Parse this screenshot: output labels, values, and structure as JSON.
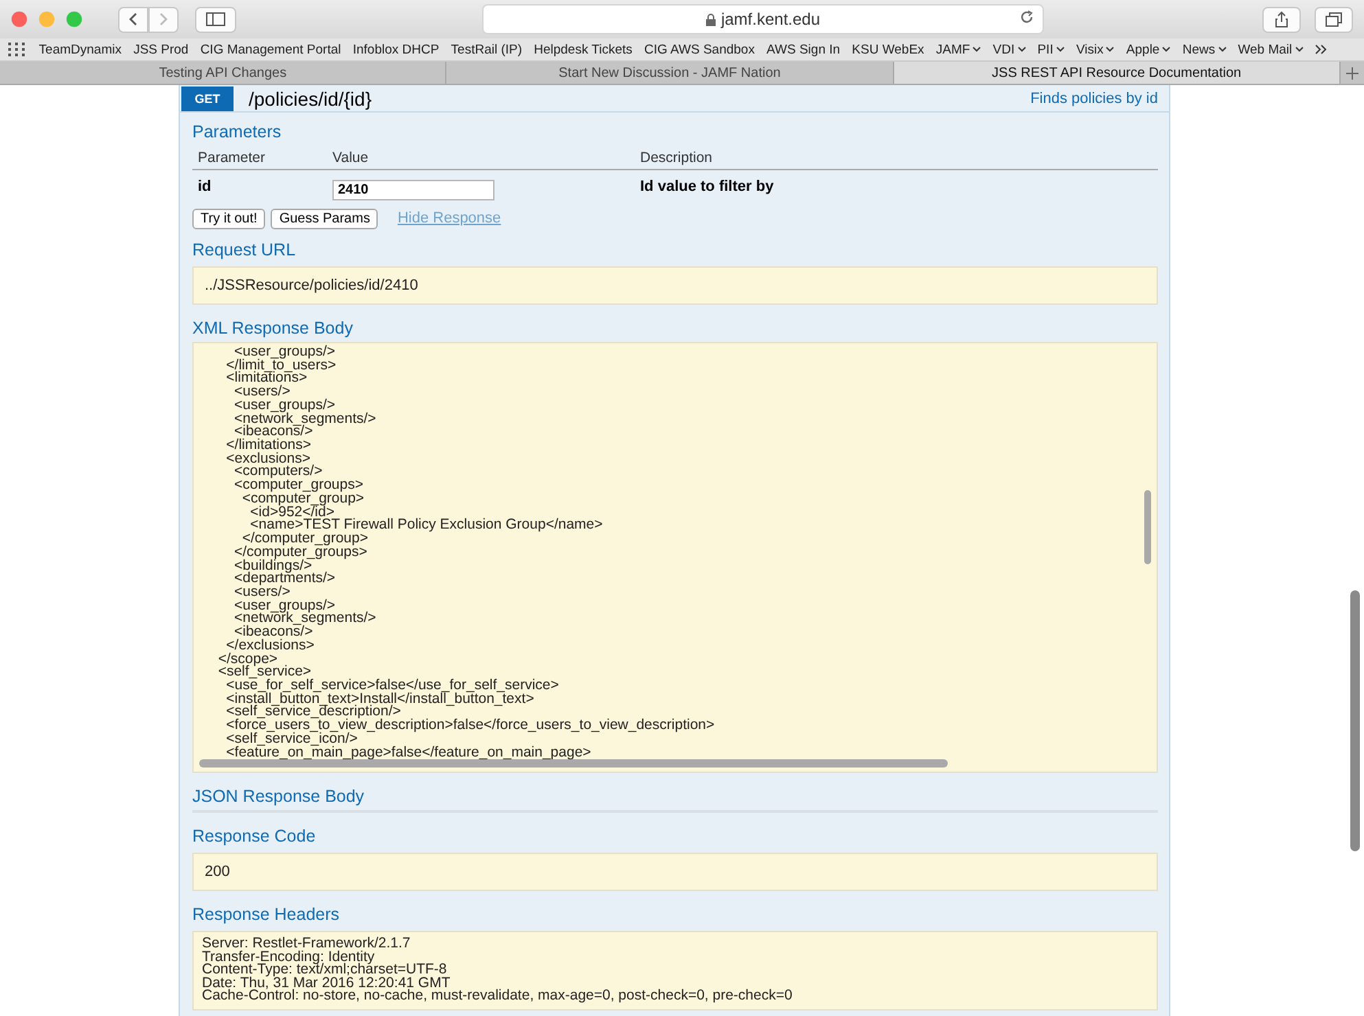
{
  "toolbar": {
    "url": "jamf.kent.edu"
  },
  "bookmarks": [
    {
      "label": "TeamDynamix",
      "kind": "link"
    },
    {
      "label": "JSS Prod",
      "kind": "link"
    },
    {
      "label": "CIG Management Portal",
      "kind": "link"
    },
    {
      "label": "Infoblox DHCP",
      "kind": "link"
    },
    {
      "label": "TestRail (IP)",
      "kind": "link"
    },
    {
      "label": "Helpdesk Tickets",
      "kind": "link"
    },
    {
      "label": "CIG AWS Sandbox",
      "kind": "link"
    },
    {
      "label": "AWS Sign In",
      "kind": "link"
    },
    {
      "label": "KSU WebEx",
      "kind": "link"
    },
    {
      "label": "JAMF",
      "kind": "folder"
    },
    {
      "label": "VDI",
      "kind": "folder"
    },
    {
      "label": "PII",
      "kind": "folder"
    },
    {
      "label": "Visix",
      "kind": "folder"
    },
    {
      "label": "Apple",
      "kind": "folder"
    },
    {
      "label": "News",
      "kind": "folder"
    },
    {
      "label": "Web Mail",
      "kind": "folder"
    }
  ],
  "tabs": [
    {
      "label": "Testing API Changes",
      "selected": false
    },
    {
      "label": "Start New Discussion - JAMF Nation",
      "selected": false
    },
    {
      "label": "JSS REST API Resource Documentation",
      "selected": true
    }
  ],
  "operation": {
    "method": "GET",
    "path": "/policies/id/{id}",
    "summary": "Finds policies by id",
    "parameters_title": "Parameters",
    "columns": [
      "Parameter",
      "Value",
      "Description"
    ],
    "parameters": [
      {
        "name": "id",
        "value": "2410",
        "description": "Id value to filter by"
      }
    ],
    "buttons": [
      "Try it out!",
      "Guess Params"
    ],
    "hide_link": "Hide Response",
    "sections": [
      {
        "kind": "text",
        "title": "Request URL",
        "lines": [
          "../JSSResource/policies/id/2410"
        ]
      },
      {
        "kind": "scroll",
        "title": "XML Response Body",
        "lines": [
          "      <user_groups/>",
          "    </limit_to_users>",
          "    <limitations>",
          "      <users/>",
          "      <user_groups/>",
          "      <network_segments/>",
          "      <ibeacons/>",
          "    </limitations>",
          "    <exclusions>",
          "      <computers/>",
          "      <computer_groups>",
          "        <computer_group>",
          "          <id>952</id>",
          "          <name>TEST Firewall Policy Exclusion Group</name>",
          "        </computer_group>",
          "      </computer_groups>",
          "      <buildings/>",
          "      <departments/>",
          "      <users/>",
          "      <user_groups/>",
          "      <network_segments/>",
          "      <ibeacons/>",
          "    </exclusions>",
          "  </scope>",
          "  <self_service>",
          "    <use_for_self_service>false</use_for_self_service>",
          "    <install_button_text>Install</install_button_text>",
          "    <self_service_description/>",
          "    <force_users_to_view_description>false</force_users_to_view_description>",
          "    <self_service_icon/>",
          "    <feature_on_main_page>false</feature_on_main_page>"
        ]
      },
      {
        "kind": "empty",
        "title": "JSON Response Body"
      },
      {
        "kind": "text",
        "title": "Response Code",
        "lines": [
          "200"
        ]
      },
      {
        "kind": "headers",
        "title": "Response Headers",
        "lines": [
          "Server: Restlet-Framework/2.1.7",
          "Transfer-Encoding: Identity",
          "Content-Type: text/xml;charset=UTF-8",
          "Date: Thu, 31 Mar 2016 12:20:41 GMT",
          "Cache-Control: no-store, no-cache, must-revalidate, max-age=0, post-check=0, pre-check=0"
        ]
      }
    ]
  }
}
